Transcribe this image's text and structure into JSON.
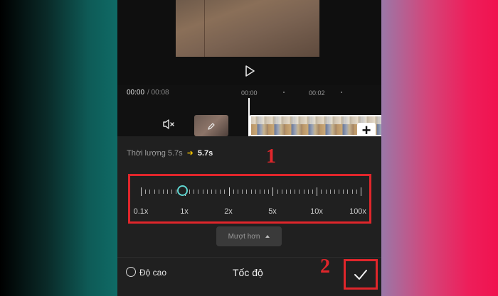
{
  "timeline": {
    "current_time": "00:00",
    "total_time": "/ 00:08",
    "ruler": [
      "00:00",
      "00:02"
    ]
  },
  "panel": {
    "duration_label": "Thời lượng 5.7s",
    "duration_arrow": "➜",
    "duration_new": "5.7s",
    "annotation_1": "1",
    "annotation_2": "2",
    "speed_options": [
      "0.1x",
      "1x",
      "2x",
      "5x",
      "10x",
      "100x"
    ],
    "selected_speed": "1x",
    "smooth_button": "Mượt hơn",
    "high_quality_label": "Độ cao",
    "title": "Tốc độ"
  },
  "colors": {
    "accent_knob": "#5fd5d0",
    "annotation_red": "#e0262b",
    "arrow_yellow": "#f2c200"
  },
  "icons": [
    "play-icon",
    "mute-icon",
    "edit-icon",
    "plus-icon",
    "caret-up-icon",
    "checkmark-icon"
  ]
}
